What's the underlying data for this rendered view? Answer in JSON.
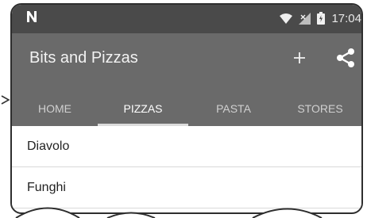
{
  "status_bar": {
    "time": "17:04",
    "left_icon": "n-notification-icon",
    "icons": [
      "wifi-icon",
      "signal-icon",
      "battery-icon"
    ]
  },
  "toolbar": {
    "title": "Bits and Pizzas",
    "add_label": "+",
    "share_icon": "share-icon"
  },
  "tabs": [
    {
      "label": "HOME",
      "active": false
    },
    {
      "label": "PIZZAS",
      "active": true
    },
    {
      "label": "PASTA",
      "active": false
    },
    {
      "label": "STORES",
      "active": false
    }
  ],
  "list": {
    "items": [
      {
        "label": "Diavolo"
      },
      {
        "label": "Funghi"
      }
    ]
  },
  "colors": {
    "status_bar": "#4a4a4a",
    "toolbar": "#6a6a6a",
    "tab_indicator": "#dcdcdc"
  }
}
